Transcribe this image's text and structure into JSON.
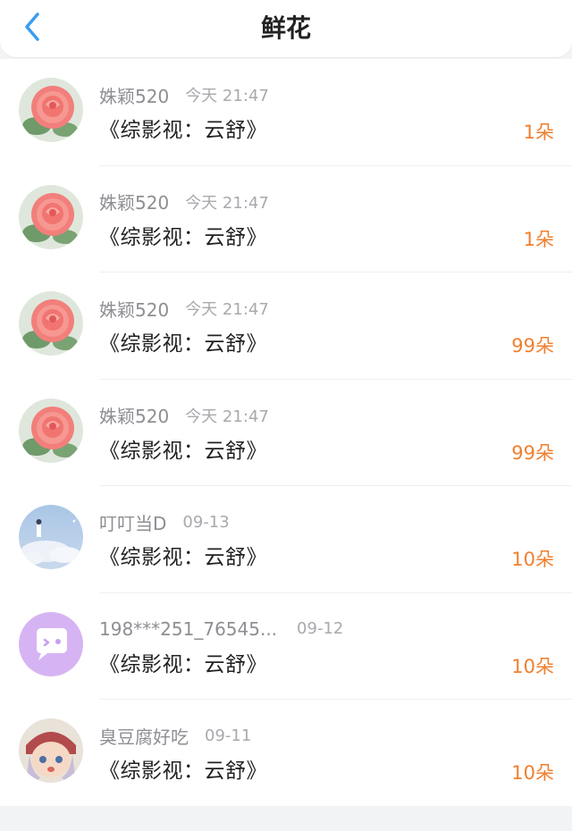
{
  "header": {
    "title": "鲜花",
    "back_icon": "chevron-left-icon",
    "accent": "#3b9cf0"
  },
  "colors": {
    "count": "#f07f2e",
    "name": "#8e8e93",
    "date": "#a9a9ae"
  },
  "items": [
    {
      "name": "姝颖520",
      "date": "今天 21:47",
      "book": "《综影视：云舒》",
      "count": "1朵",
      "avatar": "rose-avatar"
    },
    {
      "name": "姝颖520",
      "date": "今天 21:47",
      "book": "《综影视：云舒》",
      "count": "1朵",
      "avatar": "rose-avatar"
    },
    {
      "name": "姝颖520",
      "date": "今天 21:47",
      "book": "《综影视：云舒》",
      "count": "99朵",
      "avatar": "rose-avatar"
    },
    {
      "name": "姝颖520",
      "date": "今天 21:47",
      "book": "《综影视：云舒》",
      "count": "99朵",
      "avatar": "rose-avatar"
    },
    {
      "name": "叮叮当D",
      "date": "09-13",
      "book": "《综影视：云舒》",
      "count": "10朵",
      "avatar": "sky-girl-avatar"
    },
    {
      "name": "198***251_76545...",
      "date": "09-12",
      "book": "《综影视：云舒》",
      "count": "10朵",
      "avatar": "chat-bubble-avatar"
    },
    {
      "name": "臭豆腐好吃",
      "date": "09-11",
      "book": "《综影视：云舒》",
      "count": "10朵",
      "avatar": "cartoon-girl-avatar"
    }
  ]
}
